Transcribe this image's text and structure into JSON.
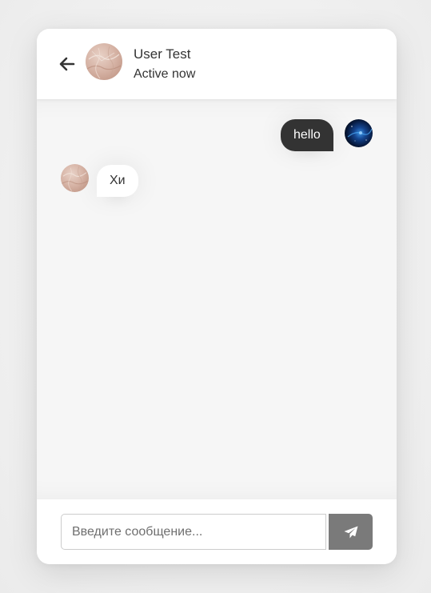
{
  "header": {
    "user_name": "User Test",
    "status": "Active now",
    "back_icon": "arrow-left-icon",
    "avatar": "user-avatar-marble"
  },
  "messages": [
    {
      "direction": "outgoing",
      "text": "hello",
      "avatar": "self-avatar-galaxy"
    },
    {
      "direction": "incoming",
      "text": "Хи",
      "avatar": "user-avatar-marble"
    }
  ],
  "composer": {
    "placeholder": "Введите сообщение...",
    "value": "",
    "send_icon": "paper-plane-icon"
  },
  "colors": {
    "outgoing_bubble": "#333333",
    "incoming_bubble": "#ffffff",
    "chat_background": "#f6f6f6",
    "send_button": "#7a7a7a",
    "text": "#333333"
  }
}
